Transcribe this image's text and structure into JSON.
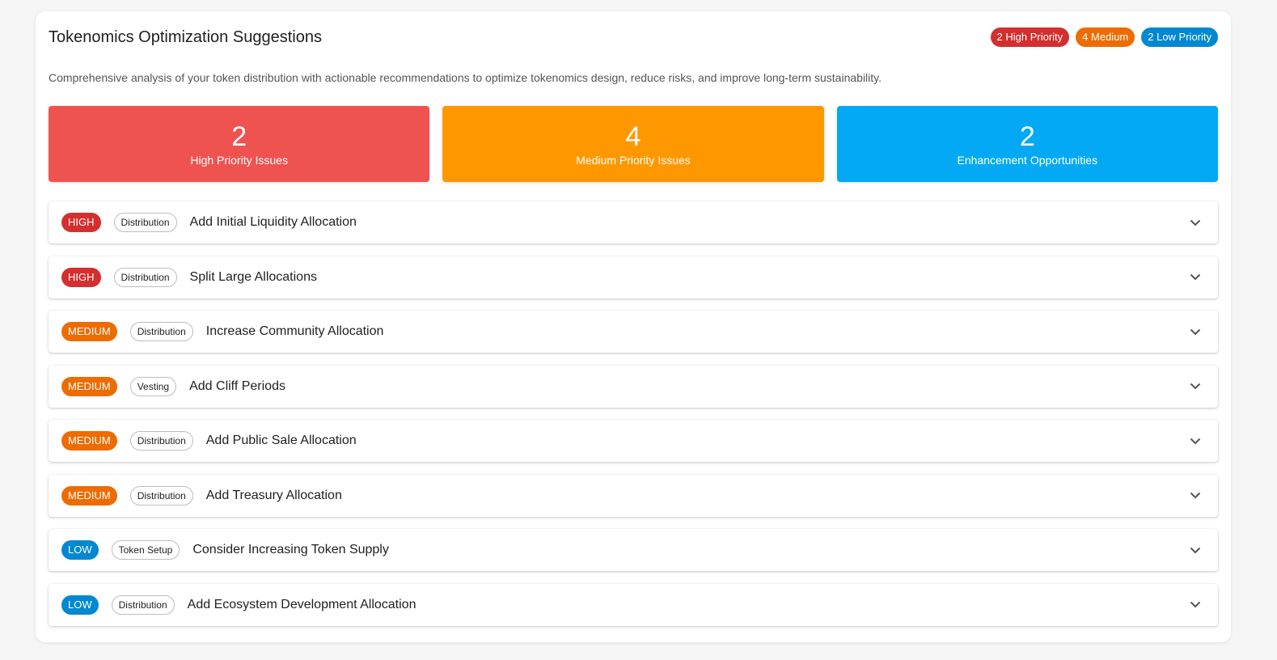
{
  "header": {
    "title": "Tokenomics Optimization Suggestions",
    "chips": {
      "high": "2 High Priority",
      "medium": "4 Medium",
      "low": "2 Low Priority"
    }
  },
  "description": "Comprehensive analysis of your token distribution with actionable recommendations to optimize tokenomics design, reduce risks, and improve long-term sustainability.",
  "stats": [
    {
      "value": "2",
      "label": "High Priority Issues",
      "color": "#ef5350"
    },
    {
      "value": "4",
      "label": "Medium Priority Issues",
      "color": "#ff9800"
    },
    {
      "value": "2",
      "label": "Enhancement Opportunities",
      "color": "#03a9f4"
    }
  ],
  "suggestions": [
    {
      "severity": "HIGH",
      "category": "Distribution",
      "title": "Add Initial Liquidity Allocation",
      "icon": "chevron-down-icon"
    },
    {
      "severity": "HIGH",
      "category": "Distribution",
      "title": "Split Large Allocations",
      "icon": "chevron-down-icon"
    },
    {
      "severity": "MEDIUM",
      "category": "Distribution",
      "title": "Increase Community Allocation",
      "icon": "chevron-down-icon"
    },
    {
      "severity": "MEDIUM",
      "category": "Vesting",
      "title": "Add Cliff Periods",
      "icon": "chevron-down-icon"
    },
    {
      "severity": "MEDIUM",
      "category": "Distribution",
      "title": "Add Public Sale Allocation",
      "icon": "chevron-down-icon"
    },
    {
      "severity": "MEDIUM",
      "category": "Distribution",
      "title": "Add Treasury Allocation",
      "icon": "chevron-down-icon"
    },
    {
      "severity": "LOW",
      "category": "Token Setup",
      "title": "Consider Increasing Token Supply",
      "icon": "chevron-down-icon"
    },
    {
      "severity": "LOW",
      "category": "Distribution",
      "title": "Add Ecosystem Development Allocation",
      "icon": "chevron-down-icon"
    }
  ],
  "colors": {
    "high": "#d32f2f",
    "medium": "#ed6c02",
    "low": "#0288d1"
  }
}
